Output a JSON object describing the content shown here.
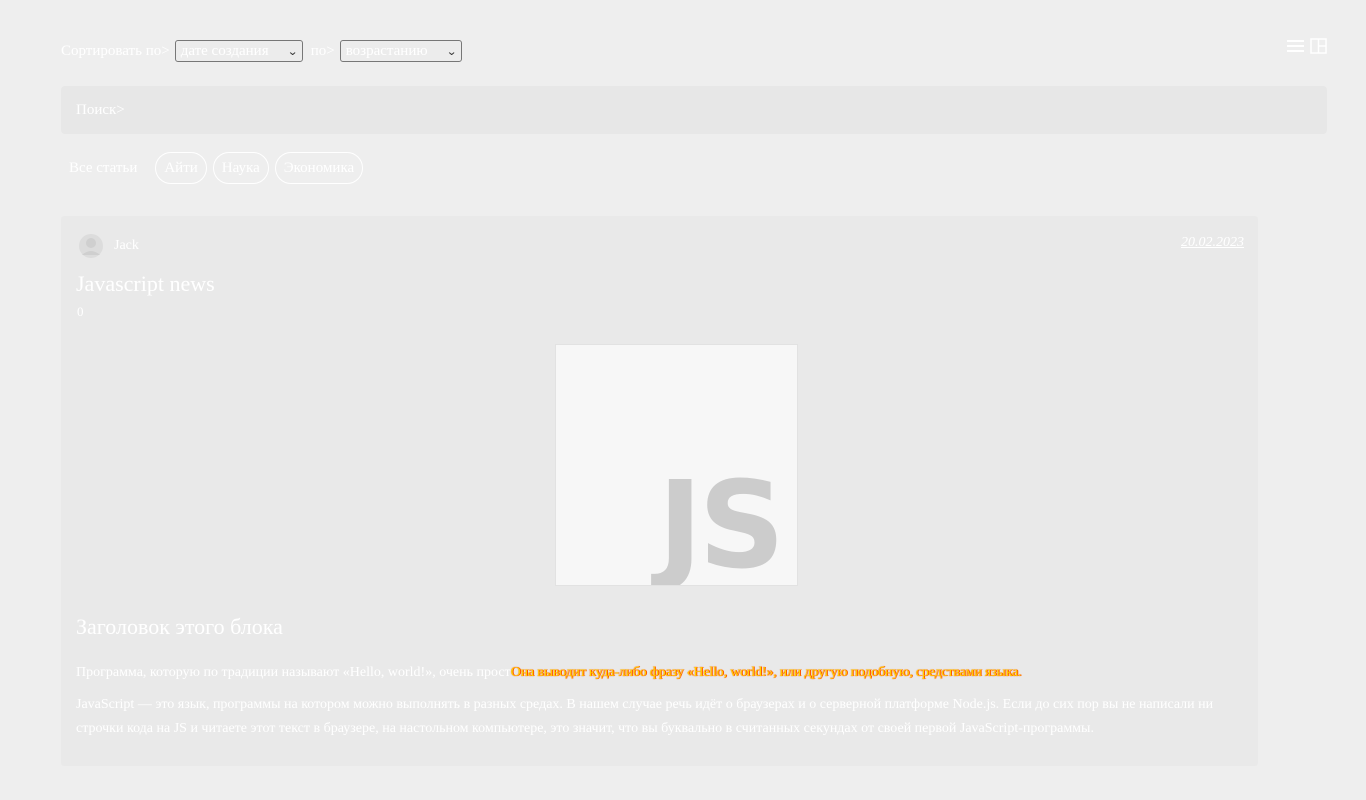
{
  "sort": {
    "label": "Сортировать по>",
    "field_value": "дате создания",
    "by_label": "по>",
    "order_value": "возрастанию"
  },
  "header_icons": [
    "menu-icon",
    "layout-icon"
  ],
  "search": {
    "label": "Поиск>"
  },
  "tags": {
    "all": "Все статьи",
    "items": [
      {
        "label": "Айти"
      },
      {
        "label": "Наука"
      },
      {
        "label": "Экономика"
      }
    ]
  },
  "article": {
    "author": "Jack",
    "date": "20.02.2023",
    "title": "Javascript news",
    "views": "0",
    "image_text": "JS",
    "block_title": "Заголовок этого блока",
    "paragraph1_start": "Программа, которую по традиции называют «Hello, world!», очень прост",
    "paragraph1_highlight": "Она выводит куда-либо фразу «Hello, world!», или другую подобную, средствами языка.",
    "paragraph2": "JavaScript — это язык, программы на котором можно выполнять в разных средах. В нашем случае речь идёт о браузерах и о серверной платформе Node.js. Если до сих пор вы не написали ни строчки кода на JS и читаете этот текст в браузере, на настольном компьютере, это значит, что вы буквально в считанных секундах от своей первой JavaScript-программы."
  },
  "colors": {
    "background": "#eeeeee",
    "card": "#e9e9e9",
    "text": "#ffffff",
    "highlight": "#ffd200"
  }
}
